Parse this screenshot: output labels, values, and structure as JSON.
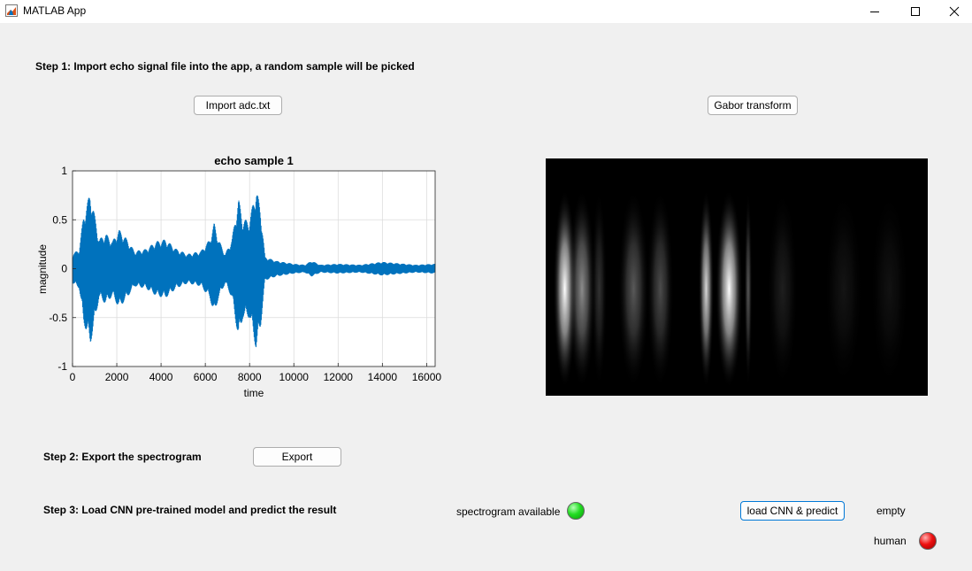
{
  "window": {
    "title": "MATLAB App"
  },
  "steps": {
    "step1": "Step 1: Import echo signal file into the app, a random sample will be picked",
    "step2": "Step 2: Export the spectrogram",
    "step3": "Step 3: Load CNN pre-trained model and predict the result"
  },
  "buttons": {
    "import": "Import adc.txt",
    "gabor": "Gabor transform",
    "export": "Export",
    "load_cnn": "load CNN & predict"
  },
  "status": {
    "spectrogram_label": "spectrogram available",
    "spectrogram_lamp": "green",
    "result_label": "empty",
    "human_label": "human",
    "human_lamp": "red"
  },
  "colors": {
    "signal": "#0072bd",
    "lamp_green": "#22dd22",
    "lamp_red": "#ee1111",
    "focus_border": "#0078d7"
  },
  "chart_data": {
    "type": "line",
    "title": "echo sample 1",
    "xlabel": "time",
    "ylabel": "magnitude",
    "xlim": [
      0,
      16384
    ],
    "ylim": [
      -1,
      1
    ],
    "grid": true,
    "x_ticks": [
      0,
      2000,
      4000,
      6000,
      8000,
      10000,
      12000,
      14000,
      16000
    ],
    "x_tick_labels": [
      "0",
      "2000",
      "4000",
      "6000",
      "8000",
      "10000",
      "12000",
      "14000",
      "16000"
    ],
    "y_ticks": [
      1,
      0.5,
      0,
      -0.5,
      -1
    ],
    "y_tick_labels": [
      "1",
      "0.5",
      "0",
      "-0.5",
      "-1"
    ],
    "series": [
      {
        "color": "#0072bd",
        "envelope": [
          {
            "x": 0,
            "amp": 0.15
          },
          {
            "x": 300,
            "amp": 0.2
          },
          {
            "x": 500,
            "amp": 0.55
          },
          {
            "x": 800,
            "amp": 0.78
          },
          {
            "x": 1000,
            "amp": 0.55
          },
          {
            "x": 1200,
            "amp": 0.3
          },
          {
            "x": 1500,
            "amp": 0.36
          },
          {
            "x": 1800,
            "amp": 0.28
          },
          {
            "x": 2100,
            "amp": 0.4
          },
          {
            "x": 2400,
            "amp": 0.32
          },
          {
            "x": 2800,
            "amp": 0.18
          },
          {
            "x": 3300,
            "amp": 0.2
          },
          {
            "x": 3800,
            "amp": 0.28
          },
          {
            "x": 4200,
            "amp": 0.3
          },
          {
            "x": 4700,
            "amp": 0.2
          },
          {
            "x": 5200,
            "amp": 0.15
          },
          {
            "x": 5800,
            "amp": 0.18
          },
          {
            "x": 6200,
            "amp": 0.3
          },
          {
            "x": 6400,
            "amp": 0.47
          },
          {
            "x": 6600,
            "amp": 0.3
          },
          {
            "x": 6900,
            "amp": 0.15
          },
          {
            "x": 7200,
            "amp": 0.3
          },
          {
            "x": 7500,
            "amp": 0.72
          },
          {
            "x": 7700,
            "amp": 0.5
          },
          {
            "x": 8000,
            "amp": 0.5
          },
          {
            "x": 8300,
            "amp": 0.83
          },
          {
            "x": 8500,
            "amp": 0.6
          },
          {
            "x": 8700,
            "amp": 0.12
          },
          {
            "x": 9200,
            "amp": 0.08
          },
          {
            "x": 10000,
            "amp": 0.05
          },
          {
            "x": 10500,
            "amp": 0.04
          },
          {
            "x": 10800,
            "amp": 0.08
          },
          {
            "x": 11200,
            "amp": 0.04
          },
          {
            "x": 12000,
            "amp": 0.05
          },
          {
            "x": 13000,
            "amp": 0.04
          },
          {
            "x": 14000,
            "amp": 0.07
          },
          {
            "x": 14500,
            "amp": 0.06
          },
          {
            "x": 15500,
            "amp": 0.04
          },
          {
            "x": 16384,
            "amp": 0.05
          }
        ]
      }
    ]
  },
  "spectrogram": {
    "description_name": "gabor-spectrogram-image",
    "bright_bands": [
      {
        "center": 0.05,
        "width": 0.03,
        "intensity": 1.0
      },
      {
        "center": 0.095,
        "width": 0.035,
        "intensity": 0.55
      },
      {
        "center": 0.14,
        "width": 0.02,
        "intensity": 0.2
      },
      {
        "center": 0.23,
        "width": 0.04,
        "intensity": 0.35
      },
      {
        "center": 0.3,
        "width": 0.035,
        "intensity": 0.3
      },
      {
        "center": 0.42,
        "width": 0.02,
        "intensity": 0.85
      },
      {
        "center": 0.48,
        "width": 0.035,
        "intensity": 1.0
      },
      {
        "center": 0.53,
        "width": 0.01,
        "intensity": 0.35
      },
      {
        "center": 0.62,
        "width": 0.04,
        "intensity": 0.12
      },
      {
        "center": 0.78,
        "width": 0.05,
        "intensity": 0.08
      },
      {
        "center": 0.9,
        "width": 0.05,
        "intensity": 0.07
      }
    ]
  }
}
